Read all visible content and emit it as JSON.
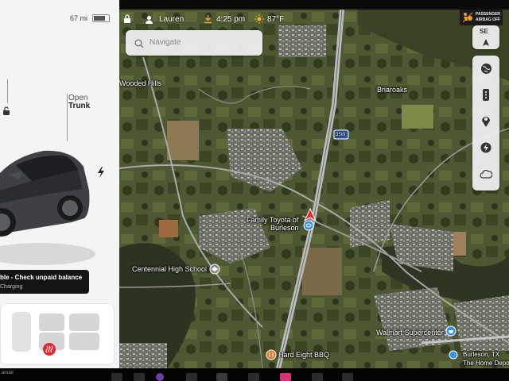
{
  "left_panel": {
    "battery_range": "67 mi",
    "open_label": "Open",
    "trunk_label": "Trunk",
    "alert": {
      "title": "ble - Check unpaid balance",
      "subtitle": "Charging"
    }
  },
  "status_bar": {
    "user_name": "Lauren",
    "time": "4:25 pm",
    "temperature": "87°F"
  },
  "passenger_airbag": {
    "line1": "PASSENGER",
    "line2": "AIRBAG OFF"
  },
  "navigate": {
    "placeholder": "Navigate"
  },
  "compass": {
    "heading": "SE"
  },
  "map": {
    "highway_shield": "35W",
    "places": {
      "wooded_hills": "Wooded Hills",
      "briaroaks": "Briaroaks",
      "family_toyota_1": "Family Toyota of",
      "family_toyota_2": "Burleson",
      "centennial": "Centennial High School",
      "walmart": "Walmart Supercenter",
      "hard_eight": "Hard Eight BBQ",
      "burleson_tx": "Burleson, TX",
      "home_depot": "The Home Depo"
    }
  },
  "dock": {
    "manual_label": "anual"
  },
  "colors": {
    "alert_bg": "#141414",
    "nav_arrow": "#e3262f",
    "poi_blue": "#3a8ee6",
    "poi_orange": "#e07a2e"
  },
  "icons": [
    "lock-icon",
    "person-icon",
    "download-icon",
    "sun-icon",
    "search-icon",
    "airbag-icon",
    "compass-icon",
    "globe-icon",
    "list-icon",
    "pin-icon",
    "bolt-icon",
    "cloud-icon",
    "seat-heat-icon"
  ]
}
